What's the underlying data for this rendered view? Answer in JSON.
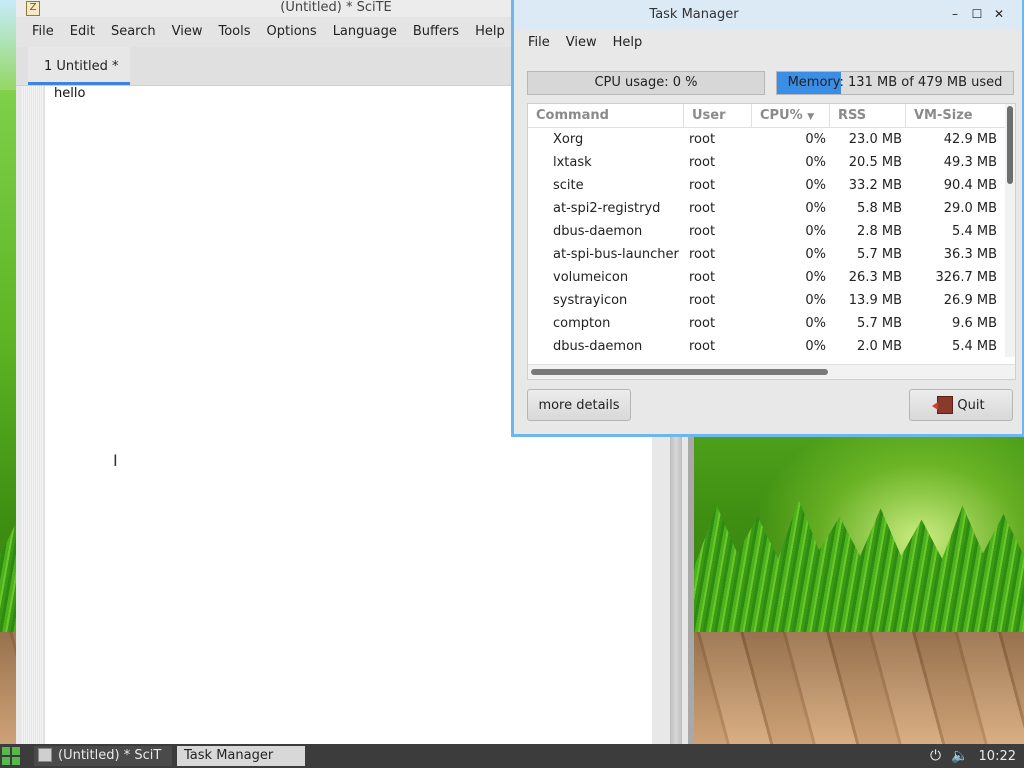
{
  "scite": {
    "title": "(Untitled) * SciTE",
    "menu": [
      "File",
      "Edit",
      "Search",
      "View",
      "Tools",
      "Options",
      "Language",
      "Buffers",
      "Help"
    ],
    "tab_label": "1 Untitled *",
    "editor_text": "hello"
  },
  "taskmanager": {
    "title": "Task Manager",
    "controls": {
      "minimize": "–",
      "maximize": "☐",
      "close": "✕"
    },
    "menu": [
      "File",
      "View",
      "Help"
    ],
    "cpu_text": "CPU usage: 0 %",
    "cpu_percent": 0,
    "mem_text": "Memory: 131 MB of 479 MB used",
    "mem_fraction": 0.27,
    "columns": [
      "Command",
      "User",
      "CPU%",
      "RSS",
      "VM-Size"
    ],
    "sort_indicator": "▼",
    "processes": [
      {
        "cmd": "Xorg",
        "user": "root",
        "cpu": "0%",
        "rss": "23.0 MB",
        "vm": "42.9 MB"
      },
      {
        "cmd": "lxtask",
        "user": "root",
        "cpu": "0%",
        "rss": "20.5 MB",
        "vm": "49.3 MB"
      },
      {
        "cmd": "scite",
        "user": "root",
        "cpu": "0%",
        "rss": "33.2 MB",
        "vm": "90.4 MB"
      },
      {
        "cmd": "at-spi2-registryd",
        "user": "root",
        "cpu": "0%",
        "rss": "5.8 MB",
        "vm": "29.0 MB"
      },
      {
        "cmd": "dbus-daemon",
        "user": "root",
        "cpu": "0%",
        "rss": "2.8 MB",
        "vm": "5.4 MB"
      },
      {
        "cmd": "at-spi-bus-launcher",
        "user": "root",
        "cpu": "0%",
        "rss": "5.7 MB",
        "vm": "36.3 MB"
      },
      {
        "cmd": "volumeicon",
        "user": "root",
        "cpu": "0%",
        "rss": "26.3 MB",
        "vm": "326.7 MB"
      },
      {
        "cmd": "systrayicon",
        "user": "root",
        "cpu": "0%",
        "rss": "13.9 MB",
        "vm": "26.9 MB"
      },
      {
        "cmd": "compton",
        "user": "root",
        "cpu": "0%",
        "rss": "5.7 MB",
        "vm": "9.6 MB"
      },
      {
        "cmd": "dbus-daemon",
        "user": "root",
        "cpu": "0%",
        "rss": "2.0 MB",
        "vm": "5.4 MB"
      }
    ],
    "more_details_label": "more details",
    "quit_label": "Quit"
  },
  "taskbar": {
    "tasks": [
      "(Untitled) * SciT",
      "Task Manager"
    ],
    "clock": "10:22",
    "icons": [
      "power-icon",
      "volume-icon"
    ]
  },
  "colors": {
    "accent": "#3c84e0",
    "mem_fill": "#3b8ee6",
    "window_border": "#6eb7ea"
  }
}
